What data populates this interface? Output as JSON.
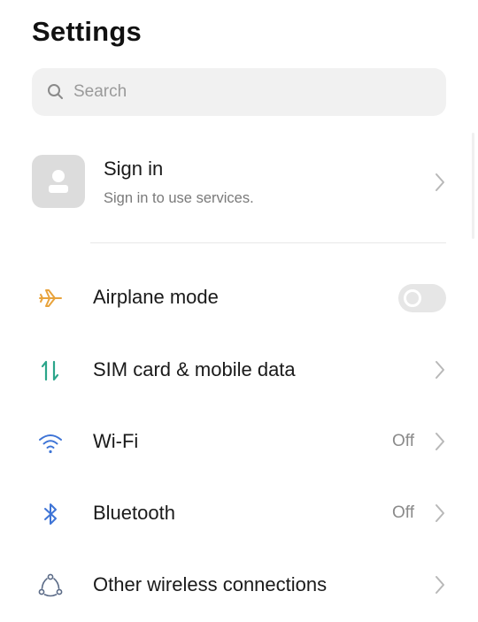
{
  "header": {
    "title": "Settings"
  },
  "search": {
    "placeholder": "Search",
    "icon": "search-icon"
  },
  "account": {
    "title": "Sign in",
    "subtitle": "Sign in to use services.",
    "icon": "person-icon"
  },
  "rows": [
    {
      "label": "Airplane mode",
      "icon": "airplane-icon",
      "control": "toggle",
      "toggle_on": false,
      "icon_color": "#e8a33c"
    },
    {
      "label": "SIM card & mobile data",
      "icon": "sim-data-icon",
      "control": "chevron",
      "icon_color": "#2ba58a"
    },
    {
      "label": "Wi-Fi",
      "value": "Off",
      "icon": "wifi-icon",
      "control": "chevron",
      "icon_color": "#3e74d6"
    },
    {
      "label": "Bluetooth",
      "value": "Off",
      "icon": "bluetooth-icon",
      "control": "chevron",
      "icon_color": "#3e74d6"
    },
    {
      "label": "Other wireless connections",
      "icon": "wireless-connections-icon",
      "control": "chevron",
      "icon_color": "#5a6a86"
    }
  ],
  "colors": {
    "text_primary": "#1a1a1a",
    "text_secondary": "#8a8a8a",
    "search_bg": "#f1f1f1",
    "toggle_off": "#e6e6e6"
  }
}
